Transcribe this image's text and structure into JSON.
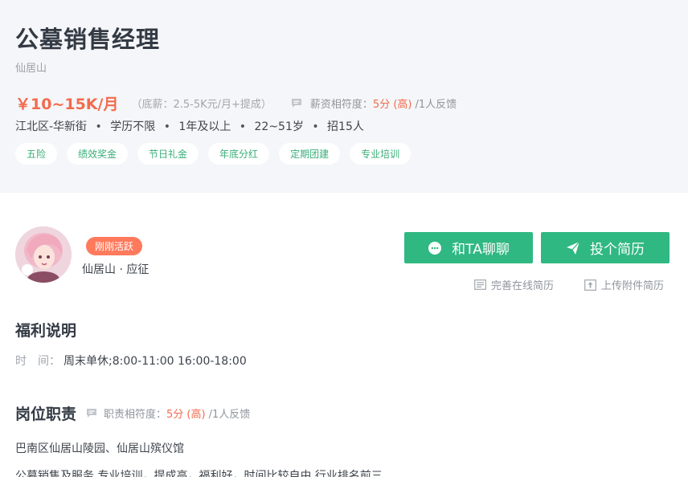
{
  "job": {
    "title": "公墓销售经理",
    "company": "仙居山",
    "salary": "￥10~15K/月",
    "base_salary": "（底薪：2.5-5K元/月+提成）",
    "match_label": "薪资相符度：",
    "match_score": "5分 (高)",
    "match_feedback": "/1人反馈",
    "location": "江北区-华新街",
    "education": "学历不限",
    "experience": "1年及以上",
    "age": "22~51岁",
    "headcount": "招15人",
    "meta_separator": "•",
    "tags": [
      "五险",
      "绩效奖金",
      "节日礼金",
      "年底分红",
      "定期团建",
      "专业培训"
    ]
  },
  "poster": {
    "active_badge": "刚刚活跃",
    "name": "仙居山 · 应征"
  },
  "actions": {
    "chat_label": "和TA聊聊",
    "resume_label": "投个简历",
    "online_resume": "完善在线简历",
    "upload_resume": "上传附件简历"
  },
  "welfare": {
    "title": "福利说明",
    "time_label": "时　间：",
    "time_value": "周末单休;8:00-11:00 16:00-18:00"
  },
  "duties": {
    "title": "岗位职责",
    "match_label": "职责相符度：",
    "match_score": "5分 (高)",
    "match_feedback": "/1人反馈",
    "line1": "巴南区仙居山陵园、仙居山殡仪馆",
    "line2": "公墓销售及服务,专业培训，提成高，福利好，时间比较自由,行业排名前三"
  },
  "colors": {
    "accent_green": "#2fb882",
    "salary_orange": "#f26b4d",
    "badge_orange": "#ff7a5c",
    "tag_green": "#3aae78"
  },
  "icons": [
    "comment-icon",
    "chat-bubble-icon",
    "send-icon",
    "resume-doc-icon",
    "upload-icon"
  ]
}
